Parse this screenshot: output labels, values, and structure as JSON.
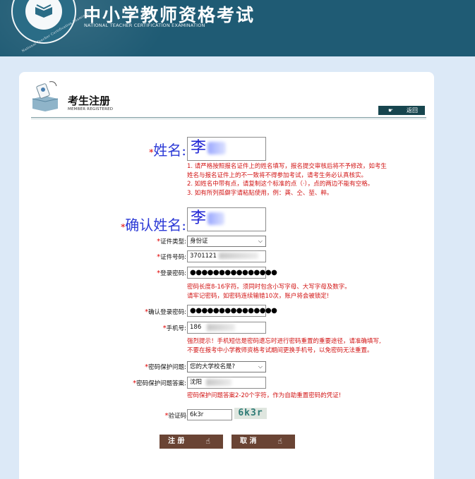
{
  "header": {
    "title": "中小学教师资格考试",
    "subtitle": "NATIONAL TEACHER CERTIFICATION EXAMINATION",
    "emblem_ring_text": "National Teacher Certification Examination",
    "colors": {
      "banner": "#1f5b74",
      "page_bg": "#dce9f7"
    }
  },
  "section": {
    "title": "考生注册",
    "subtitle": "MEMBER REGISTERED",
    "back_label": "返回"
  },
  "form": {
    "name_label": "姓名:",
    "name_value": "李",
    "name_hints": [
      "1. 请严格按照报名证件上的姓名填写，报名提交审核后将不予修改，如考生",
      "姓名与报名证件上的不一致将不得参加考试，请考生务必认真核实。",
      "2. 如姓名中带有点，请复制这个标准的点（·），点的两边不能有空格。",
      "3. 如有所列孤僻字请粘贴使用，例：龚、仝、堃、粹。"
    ],
    "confirm_name_label": "确认姓名:",
    "confirm_name_value": "李",
    "id_type_label": "证件类型:",
    "id_type_value": "身份证",
    "id_number_label": "证件号码:",
    "id_number_value": "3701121",
    "password_label": "登录密码:",
    "password_value": "●●●●●●●●●●●●●●●",
    "password_hints": [
      "密码长度8-16字符。须同时包含小写字母、大写字母及数字。",
      "请牢记密码，如密码连续输错10次，账户将会被锁定!"
    ],
    "confirm_password_label": "确认登录密码:",
    "confirm_password_value": "●●●●●●●●●●●●●●●",
    "phone_label": "手机号:",
    "phone_value": "186",
    "phone_hints": [
      "强烈提示！手机短信是密码遗忘时进行密码重置的重要途径，请准确填写,",
      "不要在报考中小学教师资格考试期间更换手机号，以免密码无法重置。"
    ],
    "security_question_label": "密码保护问题:",
    "security_question_value": "您的大学校名是?",
    "security_answer_label": "密码保护问题答案:",
    "security_answer_value": "沈阳",
    "security_answer_hint": "密码保护问题答案2-20个字符，作为自助重置密码的凭证!",
    "captcha_label": "验证码",
    "captcha_value": "6k3r",
    "captcha_image_text": "6k3r"
  },
  "actions": {
    "register_label": "注 册",
    "cancel_label": "取 消"
  }
}
